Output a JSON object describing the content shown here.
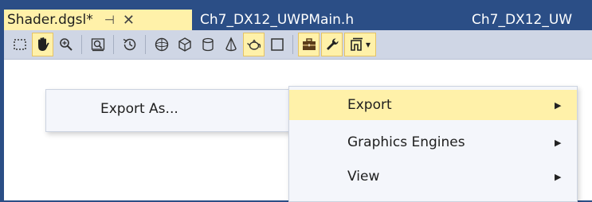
{
  "tabs": {
    "active": {
      "label": "Shader.dgsl*",
      "pin_glyph": "⊣",
      "close_glyph": "✕"
    },
    "inactive": [
      {
        "label": "Ch7_DX12_UWPMain.h"
      },
      {
        "label": "Ch7_DX12_UW"
      }
    ]
  },
  "toolbar": {
    "buttons": [
      {
        "icon": "marquee-select-icon"
      },
      {
        "icon": "pan-hand-icon",
        "active": true
      },
      {
        "icon": "zoom-icon"
      },
      {
        "icon": "frame-zoom-icon"
      },
      {
        "icon": "history-icon"
      },
      {
        "icon": "sphere-preview-icon"
      },
      {
        "icon": "cube-preview-icon"
      },
      {
        "icon": "cylinder-preview-icon"
      },
      {
        "icon": "cone-preview-icon"
      },
      {
        "icon": "teapot-preview-icon",
        "active": true
      },
      {
        "icon": "plane-preview-icon"
      },
      {
        "icon": "toolbox-icon",
        "active": true
      },
      {
        "icon": "wrench-icon",
        "active": true
      },
      {
        "icon": "export-menu-icon",
        "active": true,
        "caret": "▾"
      }
    ]
  },
  "submenu": {
    "item": "Export As..."
  },
  "menu": {
    "items": [
      {
        "label": "Export",
        "arrow": "▶",
        "highlighted": true
      },
      {
        "label": "Graphics Engines",
        "arrow": "▶"
      },
      {
        "label": "View",
        "arrow": "▶"
      }
    ]
  },
  "colors": {
    "chrome": "#2b4e86",
    "active_tab": "#fff1a9",
    "toolbar": "#cfd6e5",
    "menu_bg": "#f4f6fb",
    "menu_highlight": "#fff1a9"
  }
}
